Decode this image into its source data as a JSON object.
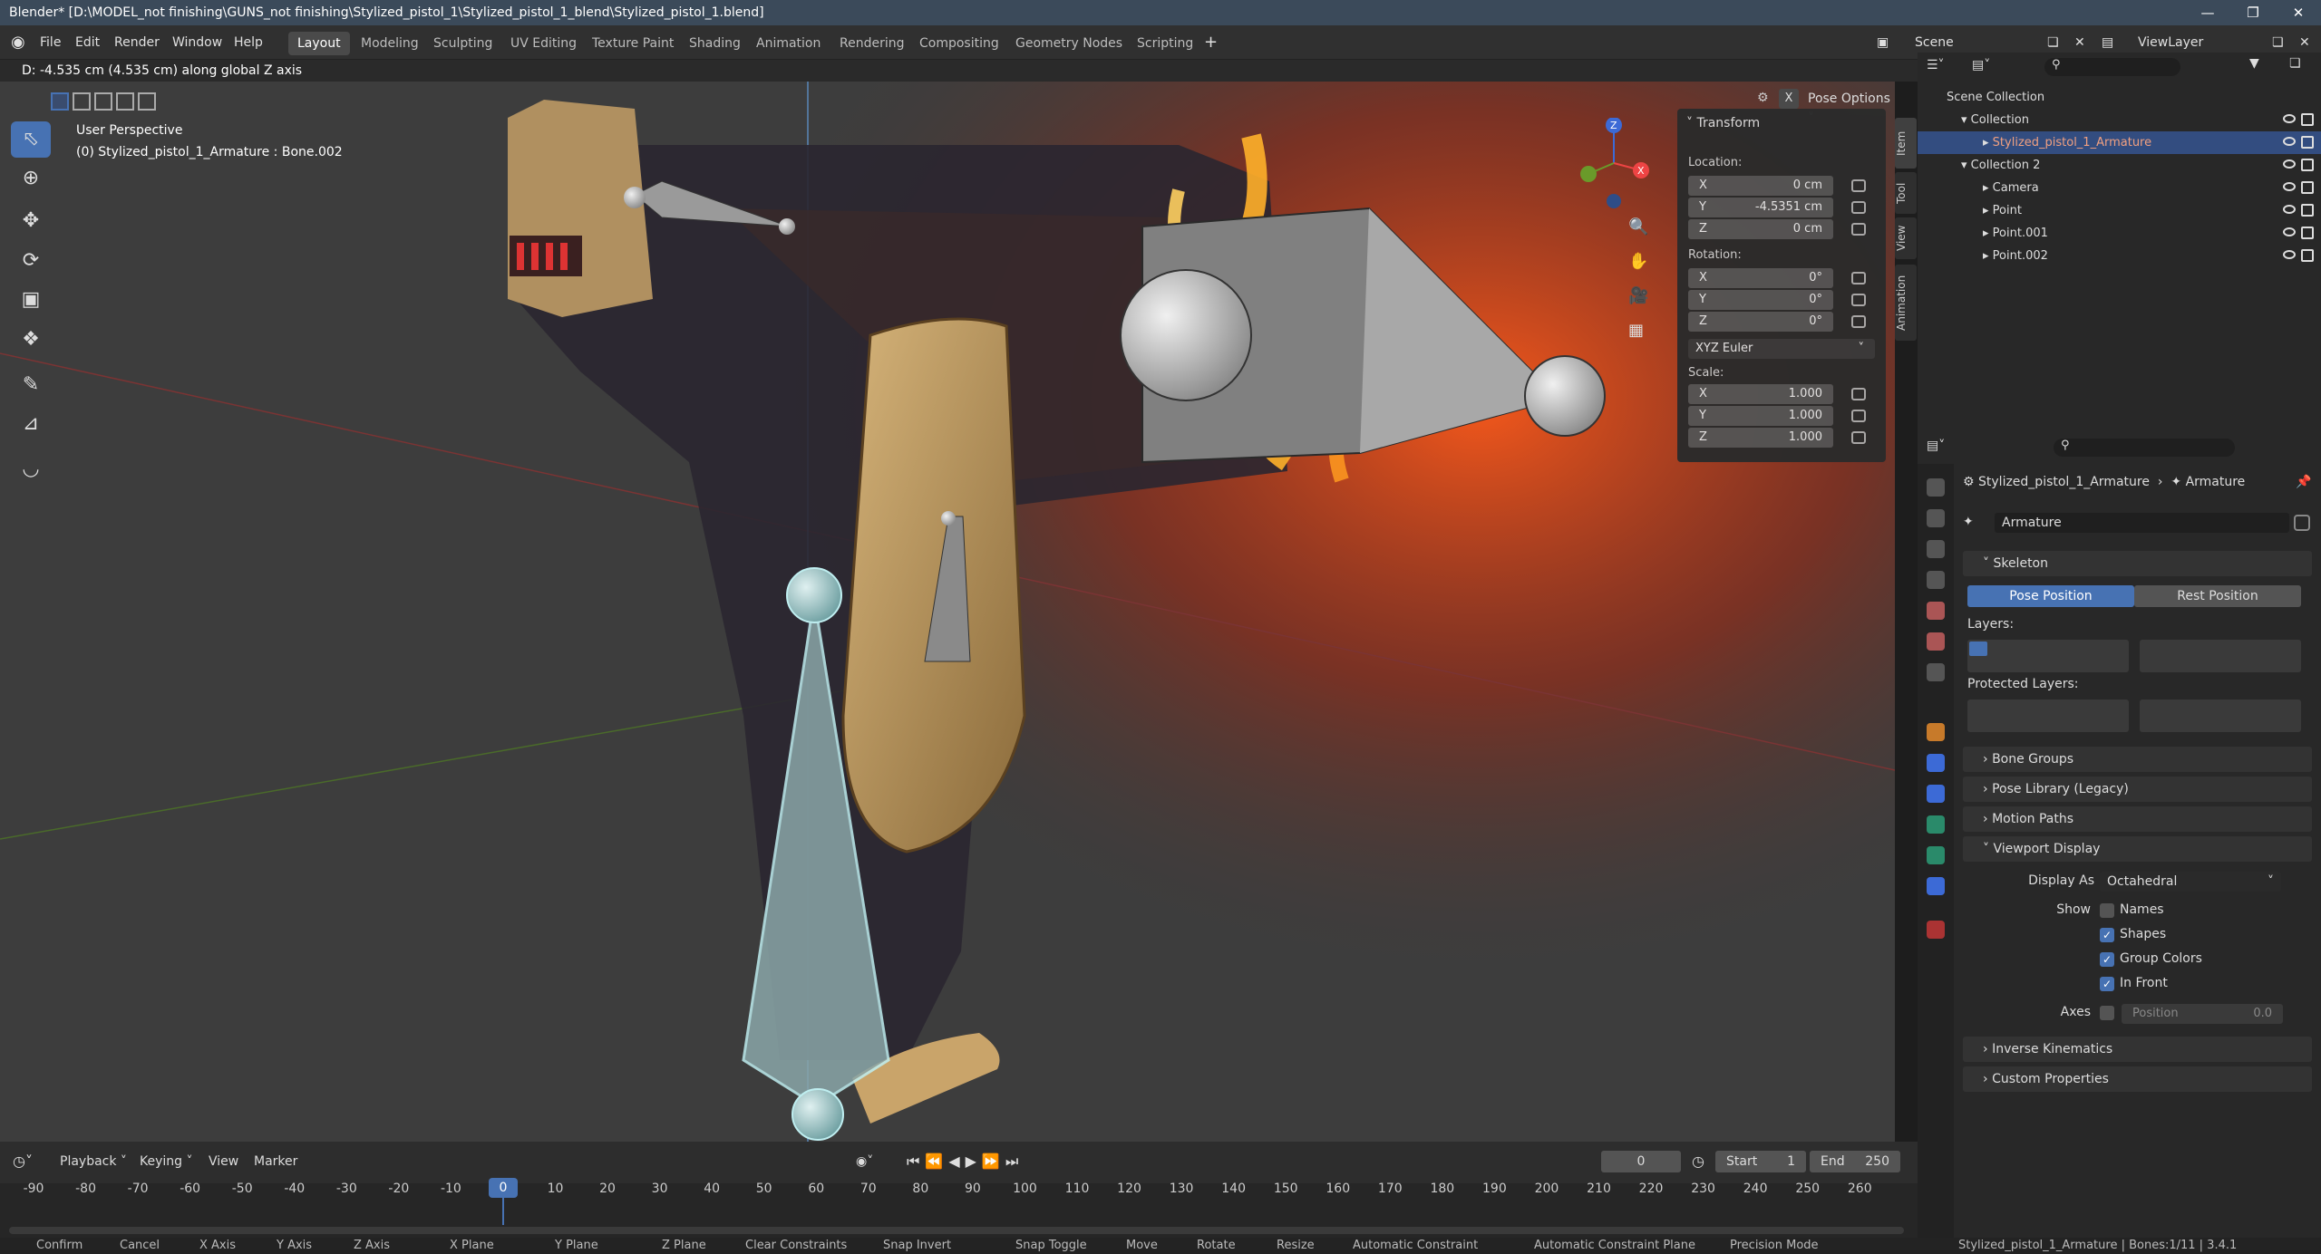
{
  "window": {
    "title": "Blender* [D:\\MODEL_not finishing\\GUNS_not finishing\\Stylized_pistol_1\\Stylized_pistol_1_blend\\Stylized_pistol_1.blend]"
  },
  "menu": [
    "File",
    "Edit",
    "Render",
    "Window",
    "Help"
  ],
  "workspaces": [
    "Layout",
    "Modeling",
    "Sculpting",
    "UV Editing",
    "Texture Paint",
    "Shading",
    "Animation",
    "Rendering",
    "Compositing",
    "Geometry Nodes",
    "Scripting"
  ],
  "scene": {
    "name": "Scene",
    "view_layer": "ViewLayer"
  },
  "header_status": "D: -4.535 cm (4.535 cm) along global Z axis",
  "viewport": {
    "perspective": "User Perspective",
    "active": "(0) Stylized_pistol_1_Armature : Bone.002",
    "pose_options": "Pose Options"
  },
  "npanel": {
    "title": "Transform",
    "location_label": "Location:",
    "location": [
      {
        "ax": "X",
        "v": "0 cm"
      },
      {
        "ax": "Y",
        "v": "-4.5351 cm"
      },
      {
        "ax": "Z",
        "v": "0 cm"
      }
    ],
    "rotation_label": "Rotation:",
    "rotation": [
      {
        "ax": "X",
        "v": "0°"
      },
      {
        "ax": "Y",
        "v": "0°"
      },
      {
        "ax": "Z",
        "v": "0°"
      }
    ],
    "rotation_mode": "XYZ Euler",
    "scale_label": "Scale:",
    "scale": [
      {
        "ax": "X",
        "v": "1.000"
      },
      {
        "ax": "Y",
        "v": "1.000"
      },
      {
        "ax": "Z",
        "v": "1.000"
      }
    ],
    "tabs": [
      "Item",
      "Tool",
      "View",
      "Animation"
    ]
  },
  "outliner": {
    "root": "Scene Collection",
    "items": [
      {
        "label": "Collection",
        "indent": 1
      },
      {
        "label": "Stylized_pistol_1_Armature",
        "indent": 2,
        "selected": true
      },
      {
        "label": "Collection 2",
        "indent": 1
      },
      {
        "label": "Camera",
        "indent": 2
      },
      {
        "label": "Point",
        "indent": 2
      },
      {
        "label": "Point.001",
        "indent": 2
      },
      {
        "label": "Point.002",
        "indent": 2
      }
    ]
  },
  "properties": {
    "breadcrumb_obj": "Stylized_pistol_1_Armature",
    "breadcrumb_data": "Armature",
    "datablock": "Armature",
    "skeleton": "Skeleton",
    "pose_position": "Pose Position",
    "rest_position": "Rest Position",
    "layers": "Layers:",
    "protected_layers": "Protected Layers:",
    "bone_groups": "Bone Groups",
    "pose_library": "Pose Library (Legacy)",
    "motion_paths": "Motion Paths",
    "viewport_display": "Viewport Display",
    "display_as_label": "Display As",
    "display_as": "Octahedral",
    "show_label": "Show",
    "names": "Names",
    "shapes": "Shapes",
    "group_colors": "Group Colors",
    "in_front": "In Front",
    "axes_label": "Axes",
    "position": "Position",
    "position_val": "0.0",
    "ik": "Inverse Kinematics",
    "custom_props": "Custom Properties"
  },
  "timeline": {
    "playback": "Playback",
    "keying": "Keying",
    "view": "View",
    "marker": "Marker",
    "current_frame": "0",
    "start_label": "Start",
    "start": "1",
    "end_label": "End",
    "end": "250",
    "ticks": [
      "-90",
      "-80",
      "-70",
      "-60",
      "-50",
      "-40",
      "-30",
      "-20",
      "-10",
      "0",
      "10",
      "20",
      "30",
      "40",
      "50",
      "60",
      "70",
      "80",
      "90",
      "100",
      "110",
      "120",
      "130",
      "140",
      "150",
      "160",
      "170",
      "180",
      "190",
      "200",
      "210",
      "220",
      "230",
      "240",
      "250",
      "260"
    ]
  },
  "statusbar": {
    "items": [
      "Confirm",
      "Cancel",
      "X Axis",
      "Y Axis",
      "Z Axis",
      "X Plane",
      "Y Plane",
      "Z Plane",
      "Clear Constraints",
      "Snap Invert",
      "Snap Toggle",
      "Move",
      "Rotate",
      "Resize",
      "Automatic Constraint",
      "Automatic Constraint Plane",
      "Precision Mode"
    ],
    "right": "Stylized_pistol_1_Armature | Bones:1/11 | 3.4.1"
  },
  "colors": {
    "accent": "#4772b3",
    "selected_row": "#334d80",
    "fire": "#ff8a1a"
  }
}
